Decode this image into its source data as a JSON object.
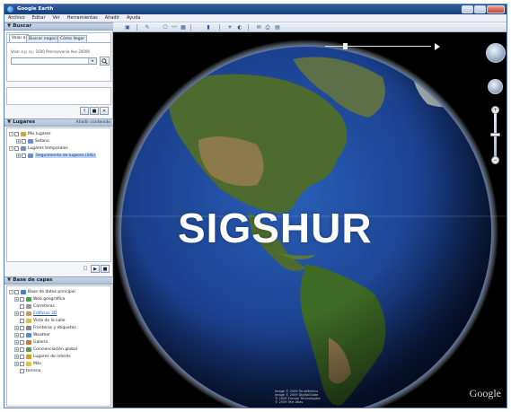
{
  "window": {
    "title": "Google Earth",
    "controls": {
      "minimize": "",
      "maximize": "",
      "close": ""
    }
  },
  "menu": [
    "Archivo",
    "Editar",
    "Ver",
    "Herramientas",
    "Añadir",
    "Ayuda"
  ],
  "search_panel": {
    "header": "Buscar",
    "tabs": [
      "Volar a",
      "Buscar negocios",
      "Cómo llegar"
    ],
    "hint": "Volar a p. ej.: 1600 Pennsylvania Ave 20006",
    "input_value": "",
    "go_icon": "search-icon"
  },
  "results_buttons": {
    "b1": "↑",
    "b2": "■",
    "b3": "✕"
  },
  "places_panel": {
    "header": "Lugares",
    "action": "Añadir contenido",
    "items": [
      {
        "label": "Mis lugares",
        "indent": 0,
        "icon_color": "#c8a53a"
      },
      {
        "label": "Sotano",
        "indent": 1,
        "icon_color": "#6b8fc4"
      },
      {
        "label": "Lugares temporales",
        "indent": 0,
        "icon_color": "#6b8fc4"
      },
      {
        "label": "Seguimiento de lugares (SIG)",
        "indent": 1,
        "icon_color": "#6b8fc4",
        "selected": true
      }
    ]
  },
  "places_footer_buttons": {
    "b1": "□",
    "b2": "▶",
    "b3": "■"
  },
  "layers_panel": {
    "header": "Base de capas",
    "action": "",
    "items": [
      {
        "label": "Base de datos principal",
        "indent": 0,
        "icon_color": "#3e82cf"
      },
      {
        "label": "Web geográfica",
        "indent": 1,
        "icon_color": "#4aa34a"
      },
      {
        "label": "Carreteras",
        "indent": 1,
        "icon_color": "#999999"
      },
      {
        "label": "Edificios 3D",
        "indent": 1,
        "icon_color": "#c0a060"
      },
      {
        "label": "Vista de la calle",
        "indent": 1,
        "icon_color": "#e0c040"
      },
      {
        "label": "Fronteras y etiquetas",
        "indent": 1,
        "icon_color": "#888888"
      },
      {
        "label": "Weather",
        "indent": 1,
        "icon_color": "#4a90d9"
      },
      {
        "label": "Galería",
        "indent": 1,
        "icon_color": "#c47a3a"
      },
      {
        "label": "Concienciación global",
        "indent": 1,
        "icon_color": "#4aa34a"
      },
      {
        "label": "Lugares de interés",
        "indent": 1,
        "icon_color": "#d4a020"
      },
      {
        "label": "Más",
        "indent": 1,
        "icon_color": "#e8c040"
      },
      {
        "label": "terreno",
        "indent": 0,
        "icon_color": ""
      }
    ]
  },
  "map": {
    "overlay_text": "SIGSHUR",
    "brand": "Google",
    "credits": [
      "Image © 2009 TerraMetrics",
      "Image © 2009 DigitalGlobe",
      "© 2009 Europa Technologies",
      "© 2009 Tele Atlas"
    ]
  },
  "colors": {
    "ocean": "#1a3f8c",
    "ocean_edge": "#0b1d4a",
    "land": "#4d6b2e",
    "land_dry": "#9c8454",
    "space": "#000000",
    "atmosphere": "#6fa3ff"
  }
}
